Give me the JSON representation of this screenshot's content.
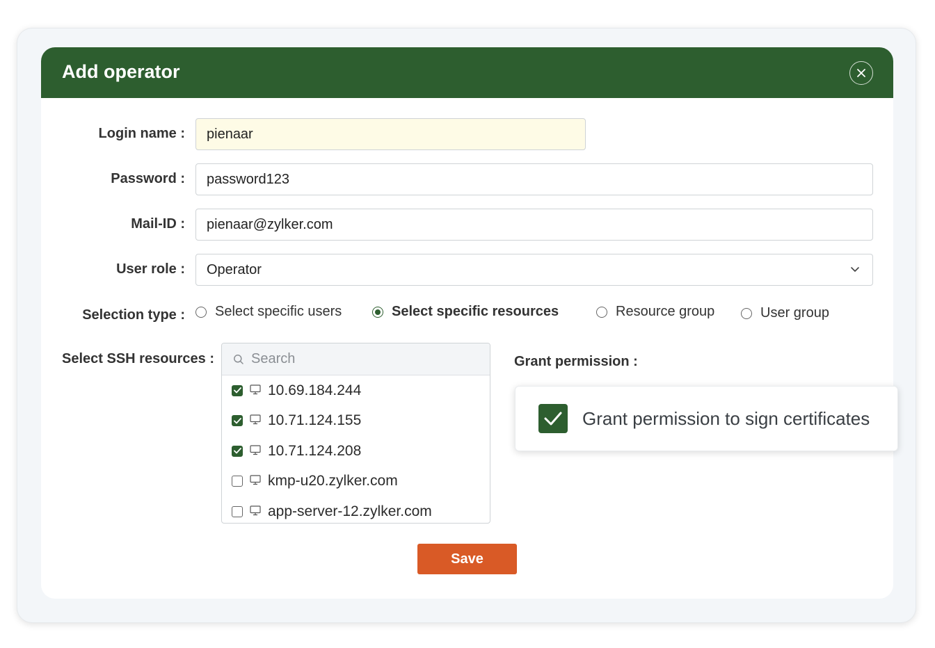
{
  "dialog": {
    "title": "Add operator"
  },
  "form": {
    "login_name": {
      "label": "Login name :",
      "value": "pienaar"
    },
    "password": {
      "label": "Password :",
      "value": "password123"
    },
    "mail_id": {
      "label": "Mail-ID :",
      "value": "pienaar@zylker.com"
    },
    "user_role": {
      "label": "User role :",
      "value": "Operator"
    },
    "selection_type": {
      "label": "Selection type :",
      "options": [
        {
          "label": "Select specific users",
          "selected": false
        },
        {
          "label": "Select specific resources",
          "selected": true
        },
        {
          "label": "Resource group",
          "selected": false
        },
        {
          "label": "User group",
          "selected": false
        }
      ]
    },
    "ssh_resources": {
      "label": "Select SSH resources :",
      "search_placeholder": "Search",
      "items": [
        {
          "name": "10.69.184.244",
          "checked": true
        },
        {
          "name": "10.71.124.155",
          "checked": true
        },
        {
          "name": "10.71.124.208",
          "checked": true
        },
        {
          "name": "kmp-u20.zylker.com",
          "checked": false
        },
        {
          "name": "app-server-12.zylker.com",
          "checked": false
        }
      ]
    },
    "grant_permission": {
      "label": "Grant permission :",
      "option": "Grant permission to sign certificates",
      "checked": true
    }
  },
  "actions": {
    "save_label": "Save"
  },
  "colors": {
    "header": "#2d5e2f",
    "accent_checkbox": "#2d5e2f",
    "save_button": "#d95a26",
    "login_field_highlight": "#fefbe6"
  },
  "icons": {
    "close": "close-icon",
    "dropdown": "chevron-down-icon",
    "search": "search-icon",
    "resource": "monitor-icon",
    "check": "check-icon"
  }
}
